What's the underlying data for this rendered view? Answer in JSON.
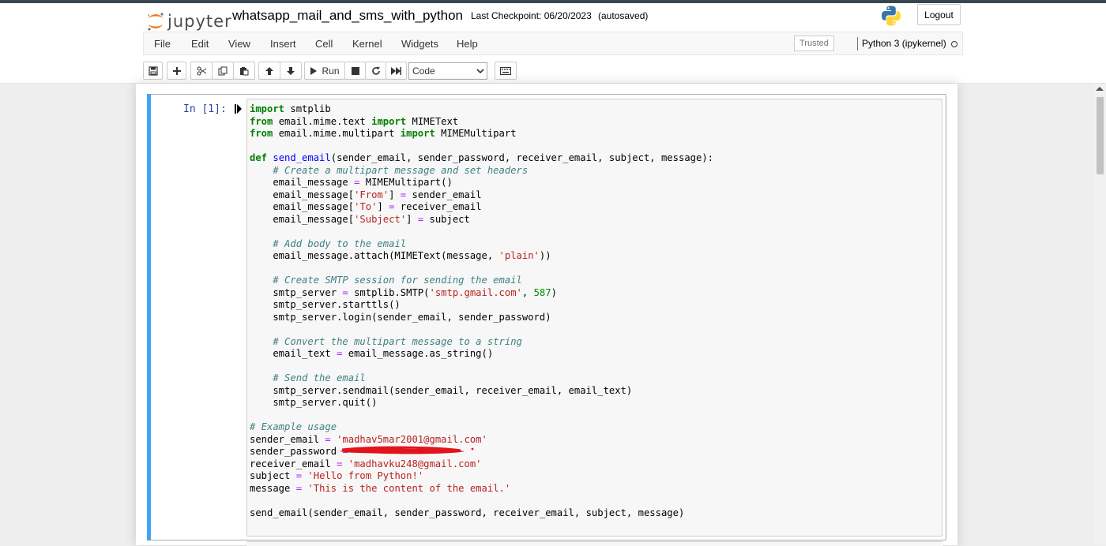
{
  "header": {
    "logo_text": "jupyter",
    "notebook_name": "whatsapp_mail_and_sms_with_python",
    "checkpoint": "Last Checkpoint: 06/20/2023",
    "autosave": "(autosaved)",
    "logout_label": "Logout"
  },
  "menu": [
    "File",
    "Edit",
    "View",
    "Insert",
    "Cell",
    "Kernel",
    "Widgets",
    "Help"
  ],
  "status": {
    "trusted": "Trusted",
    "kernel": "Python 3 (ipykernel)"
  },
  "toolbar": {
    "run_label": "Run",
    "cell_type": "Code"
  },
  "cell": {
    "prompt": "In [1]:",
    "code": [
      "import smtplib",
      "from email.mime.text import MIMEText",
      "from email.mime.multipart import MIMEMultipart",
      "",
      "def send_email(sender_email, sender_password, receiver_email, subject, message):",
      "    # Create a multipart message and set headers",
      "    email_message = MIMEMultipart()",
      "    email_message['From'] = sender_email",
      "    email_message['To'] = receiver_email",
      "    email_message['Subject'] = subject",
      "",
      "    # Add body to the email",
      "    email_message.attach(MIMEText(message, 'plain'))",
      "",
      "    # Create SMTP session for sending the email",
      "    smtp_server = smtplib.SMTP('smtp.gmail.com', 587)",
      "    smtp_server.starttls()",
      "    smtp_server.login(sender_email, sender_password)",
      "",
      "    # Convert the multipart message to a string",
      "    email_text = email_message.as_string()",
      "",
      "    # Send the email",
      "    smtp_server.sendmail(sender_email, receiver_email, email_text)",
      "    smtp_server.quit()",
      "",
      "# Example usage",
      "sender_email = 'madhav5mar2001@gmail.com'",
      "sender_password = '",
      "receiver_email = 'madhavku248@gmail.com'",
      "subject = 'Hello from Python!'",
      "message = 'This is the content of the email.'",
      "",
      "send_email(sender_email, sender_password, receiver_email, subject, message)"
    ]
  },
  "colors": {
    "cell_selected_bar": "#42a5f5",
    "redaction": "#e3131b",
    "keyword": "#008000",
    "string": "#ba2121",
    "comment": "#408080"
  },
  "icons": {
    "save": "save-icon",
    "add": "plus-icon",
    "cut": "scissors-icon",
    "copy": "copy-icon",
    "paste": "paste-icon",
    "up": "arrow-up-icon",
    "down": "arrow-down-icon",
    "run": "play-icon",
    "stop": "stop-icon",
    "restart": "restart-icon",
    "fast_forward": "fast-forward-icon",
    "keyboard": "keyboard-icon"
  }
}
